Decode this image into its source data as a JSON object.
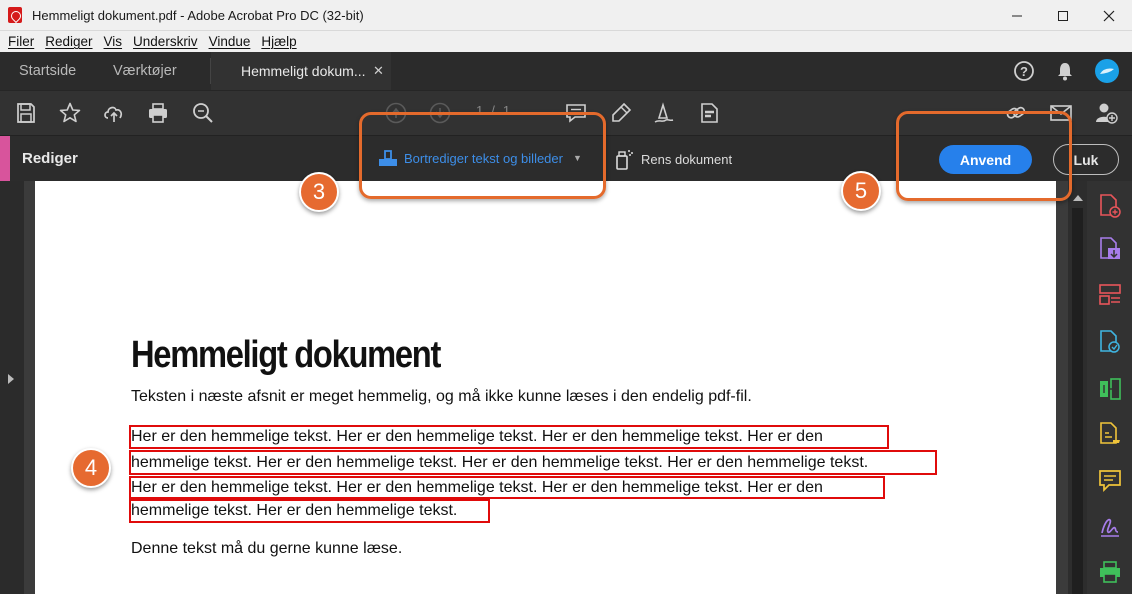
{
  "window": {
    "title": "Hemmeligt dokument.pdf - Adobe Acrobat Pro DC (32-bit)"
  },
  "menu": [
    "Filer",
    "Rediger",
    "Vis",
    "Underskriv",
    "Vindue",
    "Hjælp"
  ],
  "tabs": {
    "home": "Startside",
    "tools": "Værktøjer",
    "document": "Hemmeligt dokum..."
  },
  "toolbar": {
    "page_current": "1",
    "page_separator": "/",
    "page_total": "1"
  },
  "redact_bar": {
    "title": "Rediger",
    "redact_tool": "Bortrediger tekst og billeder",
    "clean_tool": "Rens dokument",
    "apply": "Anvend",
    "close": "Luk"
  },
  "document": {
    "title": "Hemmeligt dokument",
    "intro": "Teksten i næste afsnit er meget hemmelig, og må ikke kunne læses i den endelig pdf-fil.",
    "secret_lines": [
      "Her er den hemmelige tekst.  Her er den hemmelige tekst. Her er den hemmelige tekst. Her er den",
      "hemmelige tekst. Her er den hemmelige tekst. Her er den hemmelige tekst. Her er den hemmelige tekst.",
      "Her er den hemmelige tekst. Her er den hemmelige tekst. Her er den hemmelige tekst. Her er den",
      "hemmelige tekst. Her er den hemmelige tekst."
    ],
    "outro": "Denne tekst må du gerne kunne læse."
  },
  "annotations": {
    "step_3": "3",
    "step_4": "4",
    "step_5": "5"
  },
  "colors": {
    "accent_blue": "#2680eb",
    "redact_pink": "#d8549c",
    "callout_orange": "#e46a2c",
    "redaction_red": "#e00b0b"
  },
  "icons": {
    "toolbar": [
      "save-icon",
      "star-icon",
      "upload-icon",
      "print-icon",
      "zoom-icon",
      "page-up-icon",
      "page-down-icon",
      "comment-icon",
      "highlight-icon",
      "sign-icon",
      "redact-tool-icon",
      "link-icon",
      "email-icon",
      "add-user-icon"
    ],
    "right_panel": [
      "create-pdf-icon",
      "export-pdf-icon",
      "organize-pages-icon",
      "edit-pdf-icon",
      "compare-icon",
      "fill-sign-icon",
      "comment-panel-icon",
      "signature-icon",
      "print-production-icon"
    ]
  }
}
